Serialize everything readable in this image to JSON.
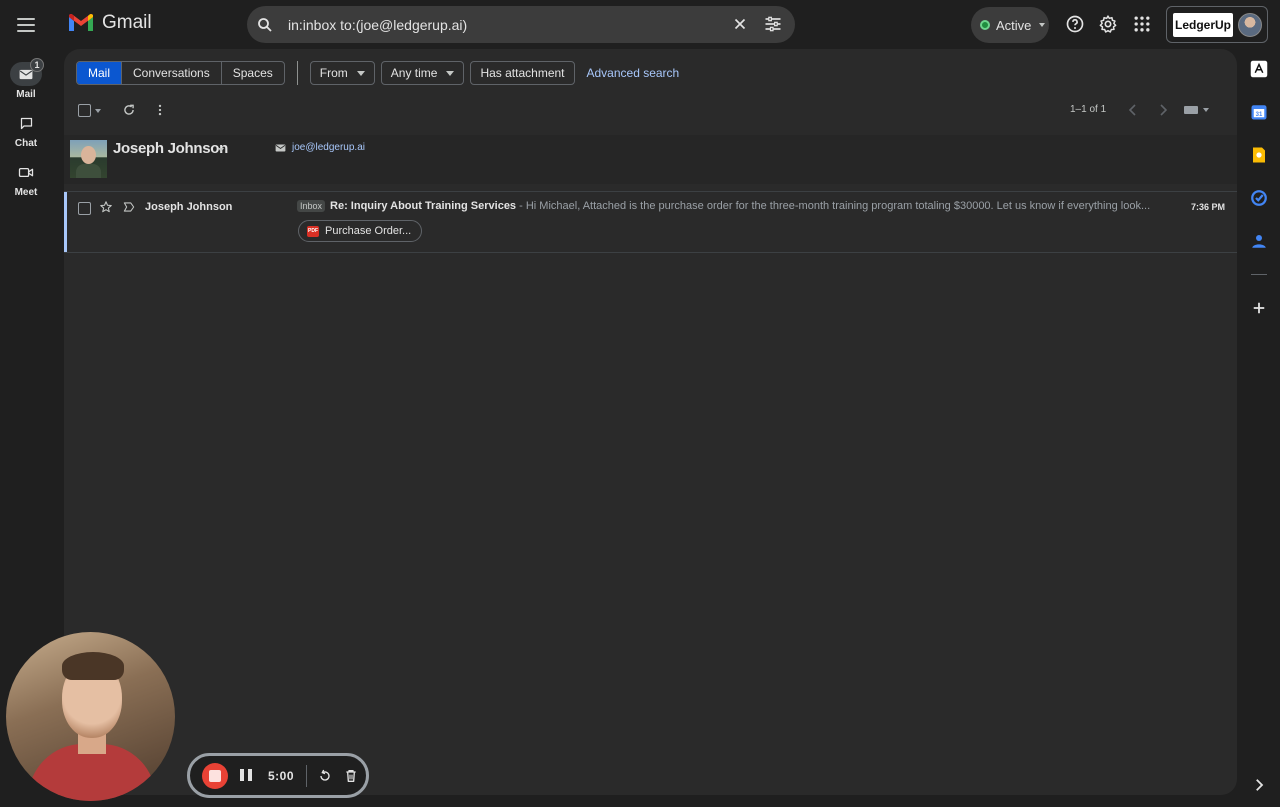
{
  "app": {
    "logo_text": "Gmail"
  },
  "search": {
    "value": "in:inbox to:(joe@ledgerup.ai)",
    "placeholder": "Search mail"
  },
  "status": {
    "label": "Active",
    "color": "#1e8e3e"
  },
  "brand": {
    "logo_text": "LedgerUp"
  },
  "leftnav": {
    "items": [
      {
        "label": "Mail",
        "icon": "mail-icon",
        "badge": "1",
        "active": true
      },
      {
        "label": "Chat",
        "icon": "chat-icon"
      },
      {
        "label": "Meet",
        "icon": "video-icon"
      }
    ]
  },
  "filters": {
    "segments": [
      "Mail",
      "Conversations",
      "Spaces"
    ],
    "selected": "Mail",
    "chips": [
      "From",
      "Any time",
      "Has attachment"
    ],
    "advanced_search": "Advanced search"
  },
  "pager": {
    "text": "1–1 of 1"
  },
  "contact": {
    "name": "Joseph Johnson",
    "email": "joe@ledgerup.ai"
  },
  "email": {
    "sender": "Joseph Johnson",
    "label": "Inbox",
    "subject": "Re: Inquiry About Training Services",
    "dash": " - ",
    "snippet": "Hi Michael, Attached is the purchase order for the three-month training program totaling $30000. Let us know if everything look...",
    "time": "7:36 PM",
    "attachment": {
      "name": "Purchase Order...",
      "type": "PDF"
    }
  },
  "recorder": {
    "time": "5:00"
  },
  "colors": {
    "accent": "#0b57d0",
    "link": "#a8c7fa",
    "record": "#e94235"
  }
}
